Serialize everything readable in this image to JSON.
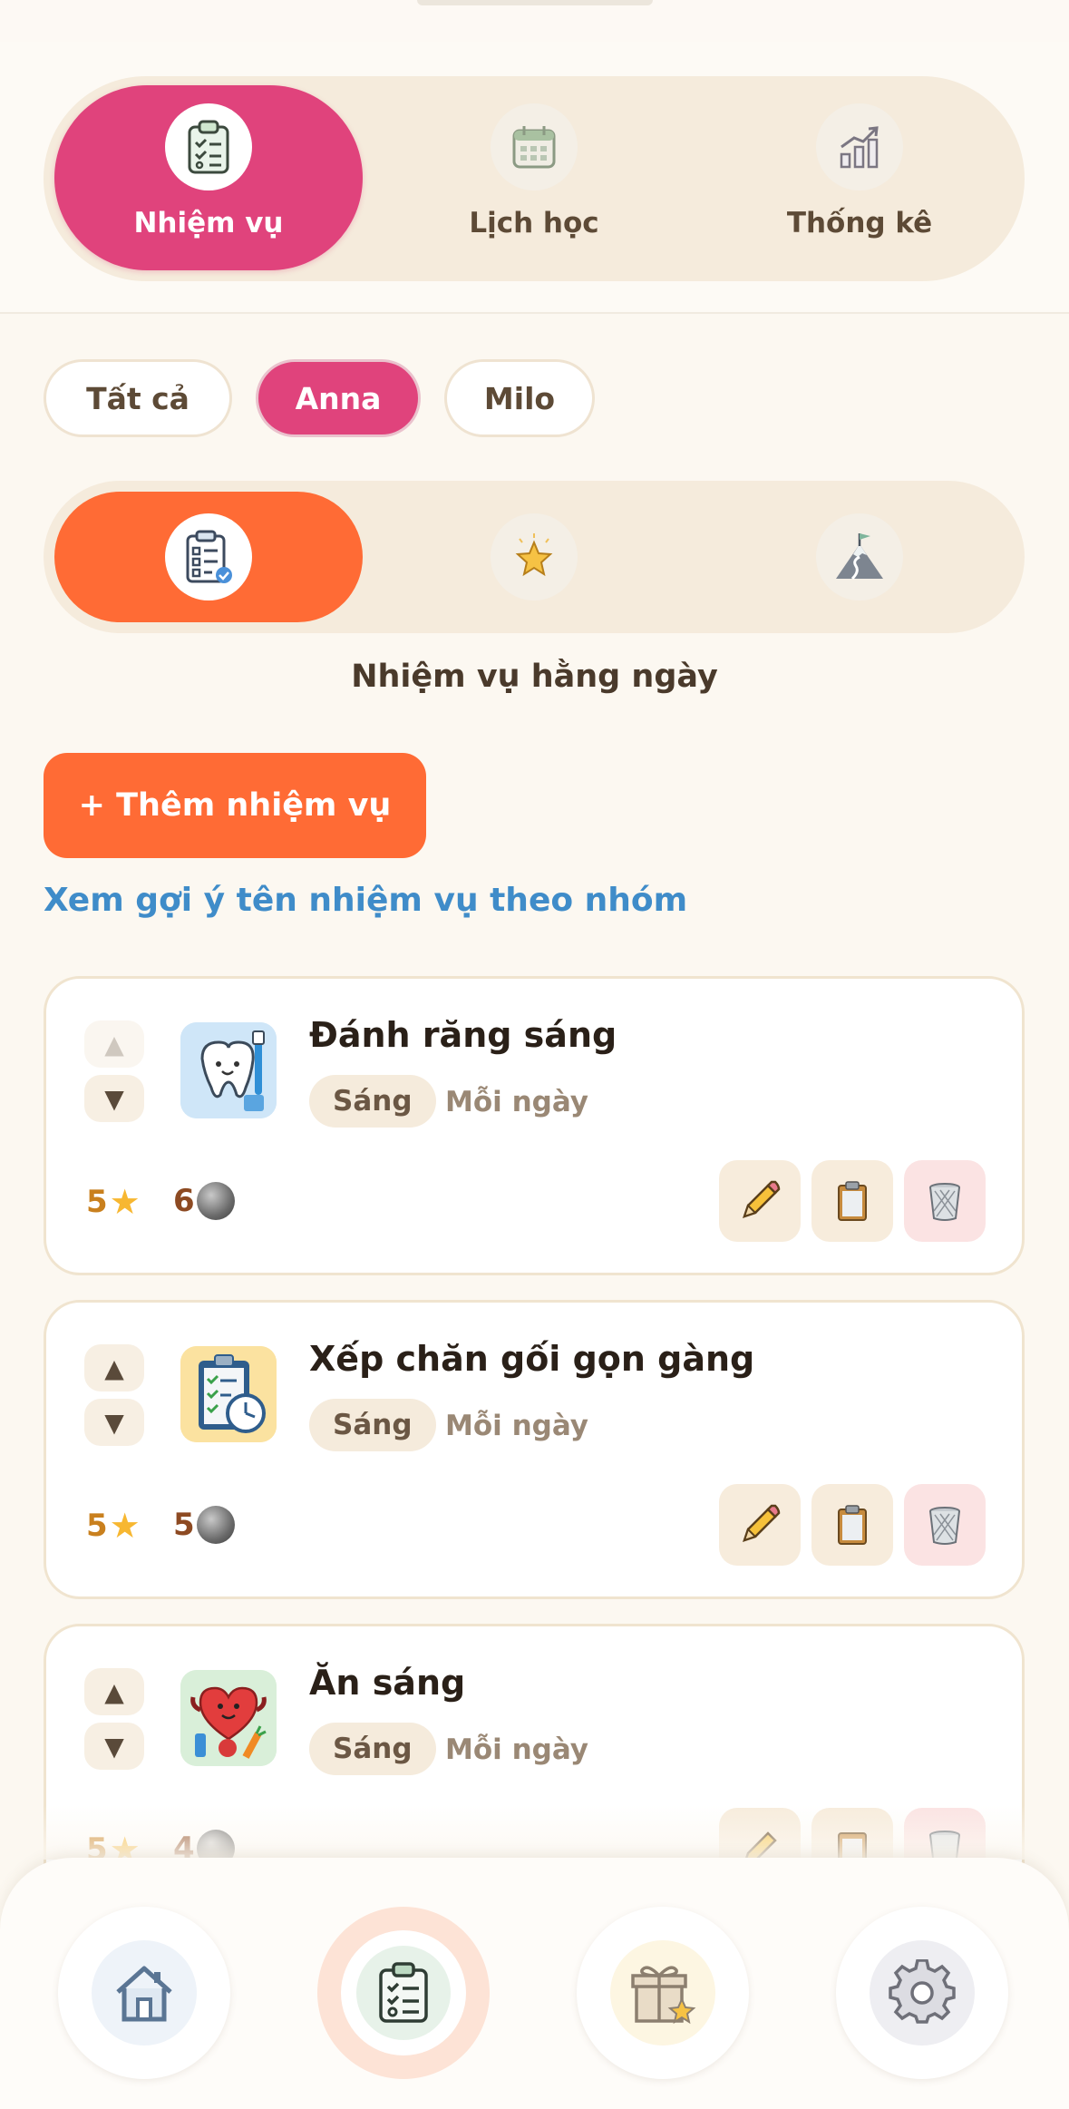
{
  "main_tabs": [
    {
      "label": "Nhiệm vụ",
      "icon": "clipboard-checklist-icon",
      "active": true
    },
    {
      "label": "Lịch học",
      "icon": "calendar-icon",
      "active": false
    },
    {
      "label": "Thống kê",
      "icon": "bar-chart-icon",
      "active": false
    }
  ],
  "filter_chips": [
    {
      "label": "Tất cả",
      "active": false
    },
    {
      "label": "Anna",
      "active": true
    },
    {
      "label": "Milo",
      "active": false
    }
  ],
  "sub_tabs": [
    {
      "icon": "daily-task-clipboard-icon",
      "active": true
    },
    {
      "icon": "star-icon",
      "active": false
    },
    {
      "icon": "mountain-flag-icon",
      "active": false
    }
  ],
  "section_title": "Nhiệm vụ hằng ngày",
  "add_button_label": "+ Thêm nhiệm vụ",
  "suggest_link": "Xem gợi ý tên nhiệm vụ theo nhóm",
  "tasks": [
    {
      "title": "Đánh răng sáng",
      "time": "Sáng",
      "frequency": "Mỗi ngày",
      "stars": "5",
      "coins": "6",
      "icon": "tooth-brush-icon",
      "up_disabled": true
    },
    {
      "title": "Xếp chăn gối gọn gàng",
      "time": "Sáng",
      "frequency": "Mỗi ngày",
      "stars": "5",
      "coins": "5",
      "icon": "checklist-clock-icon",
      "up_disabled": false
    },
    {
      "title": "Ăn sáng",
      "time": "Sáng",
      "frequency": "Mỗi ngày",
      "stars": "5",
      "coins": "4",
      "icon": "healthy-heart-food-icon",
      "up_disabled": false
    }
  ],
  "bottom_nav": [
    {
      "icon": "home-icon",
      "active": false
    },
    {
      "icon": "tasks-clipboard-icon",
      "active": true
    },
    {
      "icon": "gift-star-icon",
      "active": false
    },
    {
      "icon": "settings-gear-icon",
      "active": false
    }
  ],
  "colors": {
    "accent_pink": "#e0437c",
    "accent_orange": "#ff6b35",
    "link_blue": "#3f8cc9",
    "background": "#fcf8f1"
  }
}
